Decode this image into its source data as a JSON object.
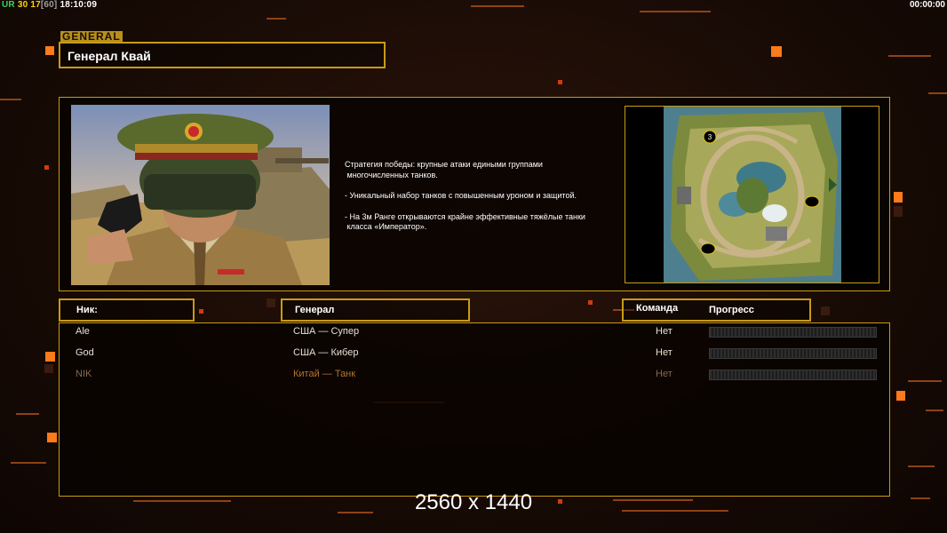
{
  "hud": {
    "ur": "UR",
    "num1": "30",
    "num2": "17",
    "num3": "[60]",
    "time": "18:10:09",
    "clock": "00:00:00"
  },
  "general": {
    "tag": "GENERAL",
    "name": "Генерал Квай",
    "description": [
      "Стратегия победы: крупные атаки едиными группами\n многочисленных танков.",
      "- Уникальный набор танков с повышенным уроном и защитой.",
      "- На 3м Ранге открываются крайне эффективные тяжёлые танки\n класса «Император»."
    ]
  },
  "map": {
    "marker_label": "3"
  },
  "table": {
    "headers": {
      "nick": "Ник:",
      "general": "Генерал",
      "team": "Команда",
      "progress": "Прогресс"
    },
    "rows": [
      {
        "name": "Ale",
        "general": "США — Супер",
        "team": "Нет"
      },
      {
        "name": "God",
        "general": "США — Кибер",
        "team": "Нет"
      },
      {
        "name": "NIK",
        "general": "Китай — Танк",
        "team": "Нет"
      }
    ]
  },
  "resolution": "2560 x 1440",
  "colors": {
    "accent": "#c99a16",
    "orange": "#ff7a1a",
    "background": "#1a0d07"
  }
}
